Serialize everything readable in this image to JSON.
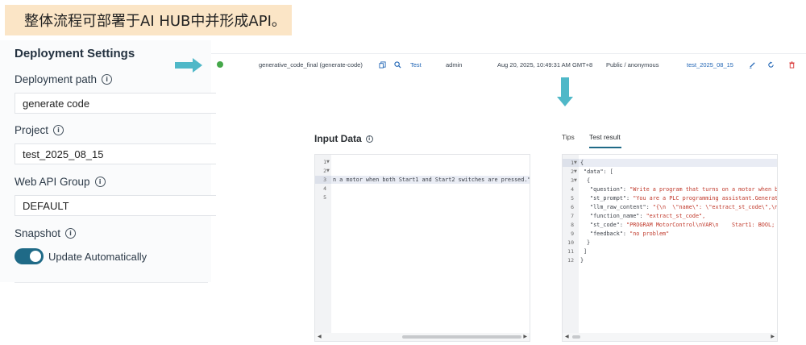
{
  "banner": {
    "text": "整体流程可部署于AI HUB中并形成API。"
  },
  "settings": {
    "title": "Deployment Settings",
    "deployment_path": {
      "label": "Deployment path",
      "value": "generate code"
    },
    "project": {
      "label": "Project",
      "value": "test_2025_08_15"
    },
    "web_api_group": {
      "label": "Web API Group",
      "value": "DEFAULT"
    },
    "snapshot": {
      "label": "Snapshot",
      "toggle_label": "Update Automatically",
      "enabled": true
    }
  },
  "deployment_row": {
    "name": "generative_code_final (generate-code)",
    "test_label": "Test",
    "user": "admin",
    "timestamp": "Aug 20, 2025, 10:49:31 AM GMT+8",
    "visibility": "Public / anonymous",
    "project_link": "test_2025_08_15"
  },
  "input_panel": {
    "title": "Input Data",
    "line_numbers": [
      "1",
      "2",
      "3",
      "4",
      "5"
    ],
    "line3_text": "n a motor when both Start1 and Start2 switches are pressed.\"]"
  },
  "tabs": {
    "tips": "Tips",
    "test_result": "Test result"
  },
  "result_panel": {
    "line_numbers": [
      "1",
      "2",
      "3",
      "4",
      "5",
      "6",
      "7",
      "8",
      "9",
      "10",
      "11",
      "12"
    ],
    "lines": {
      "l1": "{",
      "l2": "\"data\": [",
      "l3": "{",
      "l4_key": "\"question\": ",
      "l4_val": "\"Write a program that turns on a motor when b",
      "l5_key": "\"st_prompt\": ",
      "l5_val": "\"You are a PLC programming assistant.Generat",
      "l6_key": "\"llm_raw_content\": ",
      "l6_val": "\"{\\n  \\\"name\\\": \\\"extract_st_code\\\",\\n",
      "l7_key": "\"function_name\": ",
      "l7_val": "\"extract_st_code\",",
      "l8_key": "\"st_code\": ",
      "l8_val": "\"PROGRAM MotorControl\\nVAR\\n    Start1: BOOL;",
      "l9_key": "\"feedback\": ",
      "l9_val": "\"no problem\"",
      "l10": "}",
      "l11": "]",
      "l12": "}"
    }
  },
  "colors": {
    "accent": "#1f6a87",
    "link": "#2367b6",
    "arrow": "#4fb8c8",
    "status_ok": "#45a84a",
    "delete": "#d93636"
  }
}
